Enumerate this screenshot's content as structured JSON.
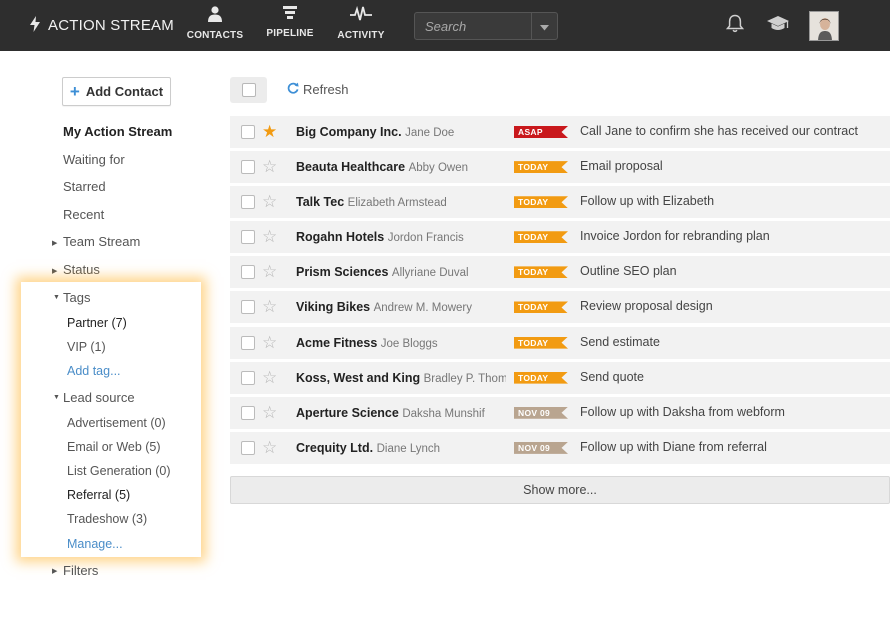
{
  "header": {
    "brand": "ACTION STREAM",
    "nav": [
      {
        "label": "CONTACTS",
        "icon": "person-icon"
      },
      {
        "label": "PIPELINE",
        "icon": "funnel-icon"
      },
      {
        "label": "ACTIVITY",
        "icon": "pulse-icon"
      }
    ],
    "search_placeholder": "Search"
  },
  "sidebar": {
    "add_contact_label": "Add Contact",
    "links": {
      "my_action_stream": "My Action Stream",
      "waiting_for": "Waiting for",
      "starred": "Starred",
      "recent": "Recent",
      "team_stream": "Team Stream",
      "status": "Status",
      "tags": "Tags",
      "lead_source": "Lead source",
      "filters": "Filters"
    },
    "tags": [
      {
        "label": "Partner (7)"
      },
      {
        "label": "VIP (1)"
      },
      {
        "label": "Add tag..."
      }
    ],
    "lead_sources": [
      {
        "label": "Advertisement (0)"
      },
      {
        "label": "Email or Web (5)"
      },
      {
        "label": "List Generation (0)"
      },
      {
        "label": "Referral (5)"
      },
      {
        "label": "Tradeshow (3)"
      },
      {
        "label": "Manage..."
      }
    ]
  },
  "toolbar": {
    "refresh_label": "Refresh"
  },
  "rows": [
    {
      "company": "Big Company Inc.",
      "contact": "Jane Doe",
      "badge": "ASAP",
      "badge_type": "asap",
      "task": "Call Jane to confirm she has received our contract",
      "starred": true
    },
    {
      "company": "Beauta Healthcare",
      "contact": "Abby Owen",
      "badge": "TODAY",
      "badge_type": "today",
      "task": "Email proposal",
      "starred": false
    },
    {
      "company": "Talk Tec",
      "contact": "Elizabeth Armstead",
      "badge": "TODAY",
      "badge_type": "today",
      "task": "Follow up with Elizabeth",
      "starred": false
    },
    {
      "company": "Rogahn Hotels",
      "contact": "Jordon Francis",
      "badge": "TODAY",
      "badge_type": "today",
      "task": "Invoice Jordon for rebranding plan",
      "starred": false
    },
    {
      "company": "Prism Sciences",
      "contact": "Allyriane Duval",
      "badge": "TODAY",
      "badge_type": "today",
      "task": "Outline SEO plan",
      "starred": false
    },
    {
      "company": "Viking Bikes",
      "contact": "Andrew M. Mowery",
      "badge": "TODAY",
      "badge_type": "today",
      "task": "Review proposal design",
      "starred": false
    },
    {
      "company": "Acme Fitness",
      "contact": "Joe Bloggs",
      "badge": "TODAY",
      "badge_type": "today",
      "task": "Send estimate",
      "starred": false
    },
    {
      "company": "Koss, West and King",
      "contact": "Bradley P. Thom",
      "badge": "TODAY",
      "badge_type": "today",
      "task": "Send quote",
      "starred": false
    },
    {
      "company": "Aperture Science",
      "contact": "Daksha Munshif",
      "badge": "NOV 09",
      "badge_type": "date",
      "task": "Follow up with Daksha from webform",
      "starred": false
    },
    {
      "company": "Crequity Ltd.",
      "contact": "Diane Lynch",
      "badge": "NOV 09",
      "badge_type": "date",
      "task": "Follow up with Diane from referral",
      "starred": false
    }
  ],
  "show_more_label": "Show more...",
  "colors": {
    "topbar": "#2e2e2e",
    "asap": "#c9181c",
    "today": "#f29b12",
    "date": "#b9a590",
    "star_on": "#f29b12",
    "highlight_glow": "#ffb028",
    "link_blue": "#4a8dc8"
  }
}
